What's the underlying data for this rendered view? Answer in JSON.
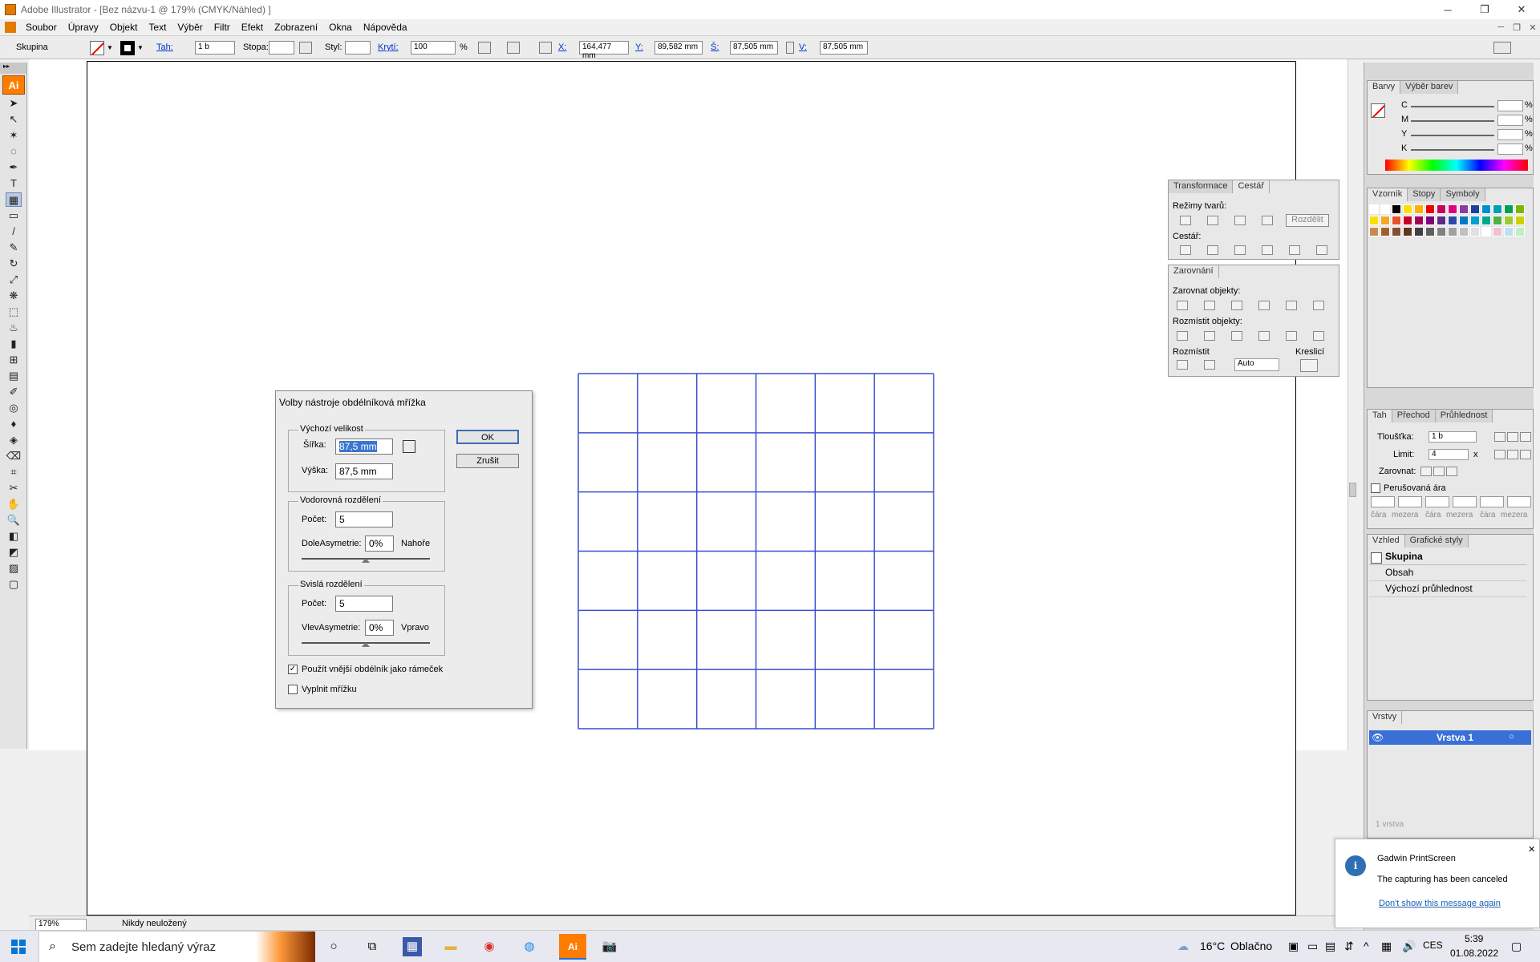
{
  "window": {
    "title": "Adobe Illustrator - [Bez názvu-1 @ 179% (CMYK/Náhled) ]",
    "minimize": "─",
    "restore": "❐",
    "close": "✕"
  },
  "menu": [
    "Soubor",
    "Úpravy",
    "Objekt",
    "Text",
    "Výběr",
    "Filtr",
    "Efekt",
    "Zobrazení",
    "Okna",
    "Nápověda"
  ],
  "control_bar": {
    "selection_label": "Skupina",
    "stroke_label": "Tah:",
    "stroke_weight": "1 b",
    "brush_label": "Stopa:",
    "style_label": "Styl:",
    "opacity_label": "Krytí:",
    "opacity_value": "100",
    "opacity_unit": "%",
    "x_label": "X:",
    "x_value": "164,477 mm",
    "y_label": "Y:",
    "y_value": "89,582 mm",
    "w_label": "Š:",
    "w_value": "87,505 mm",
    "h_label": "V:",
    "h_value": "87,505 mm"
  },
  "tools": {
    "logo": "Ai",
    "items": [
      "selection",
      "direct-selection",
      "magic-wand",
      "lasso",
      "pen",
      "type",
      "rectangular-grid",
      "rectangle",
      "paintbrush",
      "pencil",
      "rotate",
      "scale",
      "warp",
      "free-transform",
      "symbol-sprayer",
      "column-graph",
      "mesh",
      "gradient",
      "eyedropper",
      "blend",
      "live-paint",
      "live-paint-selection",
      "eraser",
      "slice",
      "scissors",
      "hand",
      "zoom"
    ]
  },
  "status_bar": {
    "zoom": "179%",
    "state": "Nikdy neuložený"
  },
  "dialog": {
    "title": "Volby nástroje obdélníková mřížka",
    "default_size_title": "Výchozí velikost",
    "width_label": "Šířka:",
    "width_value": "87,5 mm",
    "height_label": "Výška:",
    "height_value": "87,5 mm",
    "horizontal_title": "Vodorovná rozdělení",
    "h_count_label": "Počet:",
    "h_count_value": "5",
    "h_skew_label": "DoleAsymetrie:",
    "h_skew_value": "0%",
    "h_skew_end": "Nahoře",
    "vertical_title": "Svislá rozdělení",
    "v_count_label": "Počet:",
    "v_count_value": "5",
    "v_skew_label": "VlevAsymetrie:",
    "v_skew_value": "0%",
    "v_skew_end": "Vpravo",
    "use_outer_label": "Použít vnější obdélník jako rámeček",
    "use_outer_checked": true,
    "fill_grid_label": "Vyplnit mřížku",
    "fill_grid_checked": false,
    "ok_label": "OK",
    "cancel_label": "Zrušit"
  },
  "grid": {
    "rows": 6,
    "cols": 6,
    "color": "#3a4fd0"
  },
  "panels": {
    "color": {
      "tabs": [
        "Barvy",
        "Výběr barev"
      ],
      "channels": [
        "C",
        "M",
        "Y",
        "K"
      ],
      "unit": "%"
    },
    "pathfinder": {
      "tabs": [
        "Transformace",
        "Cestář"
      ],
      "shape_modes_label": "Režimy tvarů:",
      "expand_label": "Rozdělit",
      "pathfinders_label": "Cestář:"
    },
    "align": {
      "tabs": [
        "Zarovnání"
      ],
      "align_objects_label": "Zarovnat objekty:",
      "distribute_objects_label": "Rozmístit objekty:",
      "distribute_spacing_label": "Rozmístit",
      "spacing_value": "Auto",
      "align_to_label": "Kreslicí"
    },
    "swatches": {
      "tabs": [
        "Vzorník",
        "Stopy",
        "Symboly"
      ]
    },
    "stroke": {
      "tabs": [
        "Tah",
        "Přechod",
        "Průhlednost"
      ],
      "weight_label": "Tloušťka:",
      "weight_value": "1 b",
      "limit_label": "Limit:",
      "limit_value": "4",
      "limit_suffix": "x",
      "align_label": "Zarovnat:",
      "dashed_label": "Perušovaná ára",
      "dash_labels": [
        "čára",
        "mezera",
        "čára",
        "mezera",
        "čára",
        "mezera"
      ]
    },
    "appearance": {
      "tabs": [
        "Vzhled",
        "Grafické styly"
      ],
      "title": "Skupina",
      "items": [
        "Obsah",
        "Výchozí průhlednost"
      ]
    },
    "layers": {
      "tabs": [
        "Vrstvy"
      ],
      "layer_name": "Vrstva 1",
      "footer": "1 vrstva"
    }
  },
  "notification": {
    "app": "Gadwin PrintScreen",
    "message": "The capturing has been canceled",
    "link": "Don't show this message again"
  },
  "taskbar": {
    "search_placeholder": "Sem zadejte hledaný výraz",
    "weather_temp": "16°C",
    "weather_text": "Oblačno",
    "lang": "CES",
    "time": "5:39",
    "date": "01.08.2022"
  }
}
